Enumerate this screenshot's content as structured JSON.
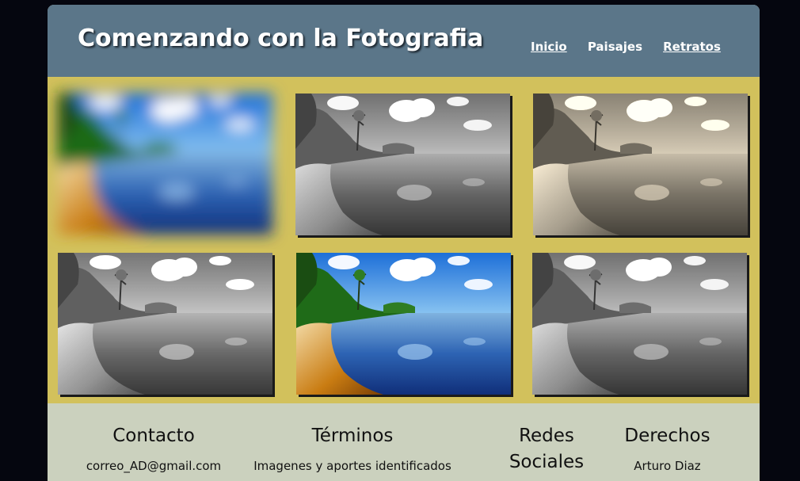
{
  "header": {
    "title": "Comenzando con la Fotografia",
    "nav": [
      {
        "label": "Inicio",
        "underlined": true
      },
      {
        "label": "Paisajes",
        "underlined": false
      },
      {
        "label": "Retratos",
        "underlined": true
      }
    ]
  },
  "gallery": {
    "photos": [
      {
        "filter": "blur"
      },
      {
        "filter": "grayscale"
      },
      {
        "filter": "sepia"
      },
      {
        "filter": "grayscale-bright"
      },
      {
        "filter": "color"
      },
      {
        "filter": "grayscale"
      }
    ]
  },
  "footer": {
    "contact": {
      "heading": "Contacto",
      "text": "correo_AD@gmail.com"
    },
    "terms": {
      "heading": "Términos",
      "text": "Imagenes y aportes identificados"
    },
    "social": {
      "heading": "Redes Sociales"
    },
    "rights": {
      "heading": "Derechos",
      "text": "Arturo Diaz"
    }
  },
  "colors": {
    "background": "#05060f",
    "header": "#5b7689",
    "gallery": "#d2c15c",
    "footer": "#cbd1be"
  }
}
